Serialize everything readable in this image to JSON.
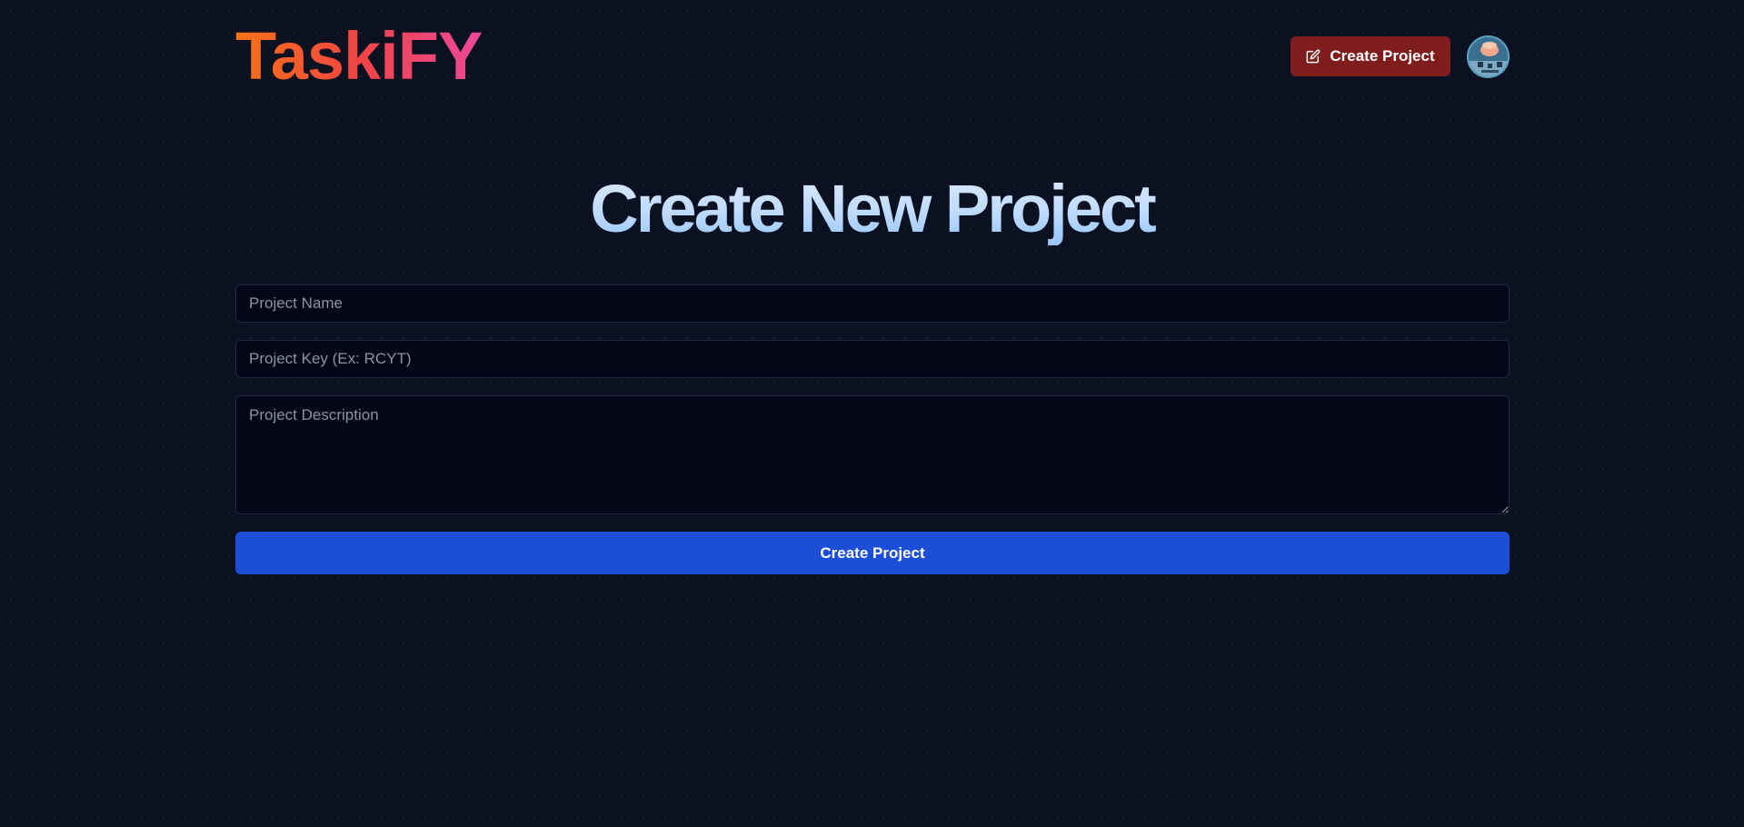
{
  "app": {
    "logo": "TaskiFY"
  },
  "header": {
    "create_button_label": "Create Project",
    "create_button_icon": "edit-icon",
    "avatar_icon": "user-avatar"
  },
  "main": {
    "title": "Create New Project",
    "form": {
      "name_placeholder": "Project Name",
      "name_value": "",
      "key_placeholder": "Project Key (Ex: RCYT)",
      "key_value": "",
      "description_placeholder": "Project Description",
      "description_value": "",
      "submit_label": "Create Project"
    }
  },
  "colors": {
    "background": "#0b1120",
    "header_button": "#7f1d1d",
    "submit_button": "#1d4ed8",
    "logo_gradient": [
      "#f97316",
      "#ef4444",
      "#ec4899"
    ],
    "title_gradient": [
      "#dbeafe",
      "#93c5fd"
    ]
  }
}
